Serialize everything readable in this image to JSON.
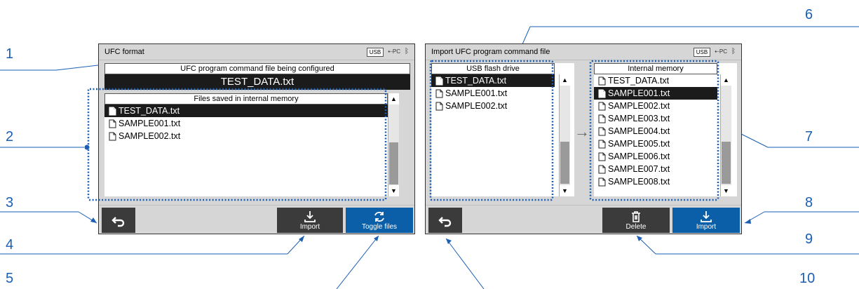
{
  "callouts": [
    "1",
    "2",
    "3",
    "4",
    "5",
    "6",
    "7",
    "8",
    "9",
    "10"
  ],
  "status": {
    "usb": "USB",
    "pc": "PC"
  },
  "left_screen": {
    "title": "UFC format",
    "configured_header": "UFC program command file being configured",
    "configured_file": "TEST_DATA.txt",
    "saved_header": "Files saved in internal memory",
    "files": [
      "TEST_DATA.txt",
      "SAMPLE001.txt",
      "SAMPLE002.txt"
    ],
    "selected_index": 0,
    "buttons": {
      "import": "Import",
      "toggle": "Toggle files"
    }
  },
  "right_screen": {
    "title": "Import UFC program command file",
    "usb_header": "USB flash drive",
    "usb_files": [
      "TEST_DATA.txt",
      "SAMPLE001.txt",
      "SAMPLE002.txt"
    ],
    "usb_selected_index": 0,
    "mem_header": "Internal memory",
    "mem_files": [
      "TEST_DATA.txt",
      "SAMPLE001.txt",
      "SAMPLE002.txt",
      "SAMPLE003.txt",
      "SAMPLE004.txt",
      "SAMPLE005.txt",
      "SAMPLE006.txt",
      "SAMPLE007.txt",
      "SAMPLE008.txt"
    ],
    "mem_selected_index": 1,
    "buttons": {
      "delete": "Delete",
      "import": "Import"
    }
  },
  "colors": {
    "callout": "#1a5fb4",
    "selected": "#1b1b1b",
    "blue_button": "#0a5fa8"
  }
}
